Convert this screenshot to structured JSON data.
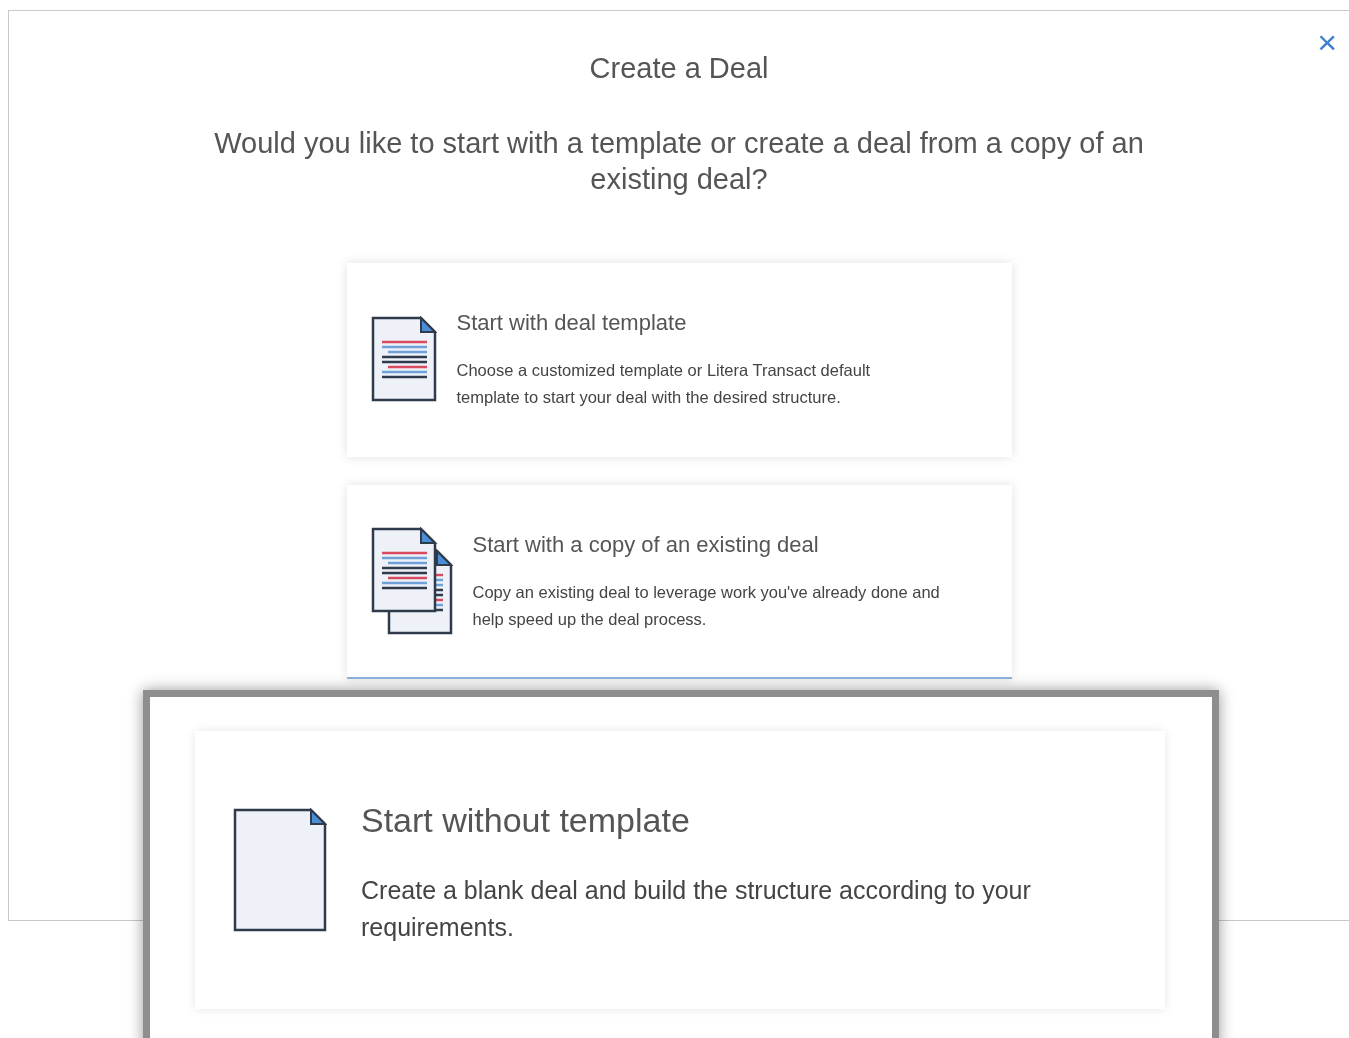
{
  "dialog": {
    "title": "Create a Deal",
    "close": "×",
    "question": "Would you like to start with a template or create a deal from a copy of an existing deal?"
  },
  "options": [
    {
      "kind": "template",
      "title": "Start with deal template",
      "description": "Choose a customized template or Litera Transact default template to start your deal with the desired structure.",
      "selected": false
    },
    {
      "kind": "copy",
      "title": "Start with a copy of an existing deal",
      "description": "Copy an existing deal to leverage work you've already done and help speed up the deal process.",
      "selected": true
    }
  ],
  "callout": {
    "kind": "blank",
    "title": "Start without template",
    "description": "Create a blank deal and build the structure according to your requirements."
  }
}
